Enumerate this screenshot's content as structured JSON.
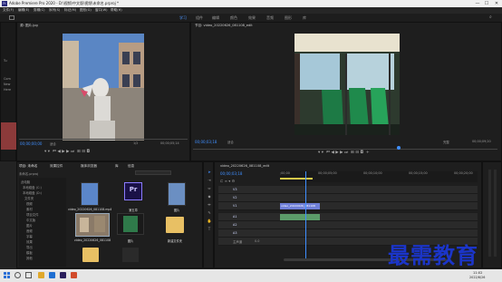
{
  "titlebar": {
    "title": "Adobe Premiere Pro 2020 - D:\\视频\\中文版\\视频\\未命名.prproj *",
    "minimize": "—",
    "maximize": "☐",
    "close": "✕"
  },
  "menu": [
    "文件(F)",
    "编辑(E)",
    "剪辑(C)",
    "序列(S)",
    "标记(M)",
    "图形(G)",
    "窗口(W)",
    "帮助(H)"
  ],
  "workspaces": [
    "学习",
    "组件",
    "编辑",
    "颜色",
    "效果",
    "音频",
    "图形",
    "库"
  ],
  "source": {
    "title": "源: 图片.jpg",
    "timecode_left": "00;00;00;00",
    "fit": "适合",
    "scale": "1/2",
    "timecode_right": "00;00;05;14"
  },
  "program": {
    "title": "节目: video_20220626_081108_edit",
    "timecode_left": "00;00;03;18",
    "fit": "适合",
    "scale": "完整",
    "timecode_right": "00;00;09;20"
  },
  "effect_controls_hint": [
    "Tu",
    "Com",
    "New",
    "Here"
  ],
  "project": {
    "tabs": [
      "项目: 未命名",
      "效果控件",
      "媒体浏览器",
      "库",
      "信息"
    ],
    "filepath": "未命名.prproj",
    "tree": [
      "此电脑",
      "本地磁盘 (C:)",
      "本地磁盘 (D:)",
      "文件夹",
      "视频",
      "素材",
      "项目文件",
      "中文版",
      "图片",
      "音频",
      "字幕",
      "效果",
      "导出",
      "模板",
      "其他"
    ],
    "items": [
      {
        "label": "video_20220626_081108.mp4",
        "kind": "blue"
      },
      {
        "label": "第五章",
        "kind": "pr"
      },
      {
        "label": "图片",
        "kind": "blue"
      },
      {
        "label": "video_20220626_081108",
        "kind": "street"
      },
      {
        "label": "图片",
        "kind": "tram"
      },
      {
        "label": "新建文件夹",
        "kind": "folder"
      },
      {
        "label": "",
        "kind": "folder"
      },
      {
        "label": "",
        "kind": "dark"
      }
    ]
  },
  "timeline": {
    "title": "video_20220626_081108_edit",
    "timecode": "00;00;03;18",
    "ruler": [
      ";00;00",
      "00;00;05;00",
      "00;00;10;00",
      "00;00;15;00",
      "00;00;20;00"
    ],
    "tracks": [
      "V3",
      "V2",
      "V1",
      "A1",
      "A2",
      "A3",
      "主声道"
    ],
    "master_value": "0.0",
    "clip_video": "video_20220626_081108",
    "clip_audio": ""
  },
  "taskbar": {
    "time": "11:02",
    "date": "2022/6/26"
  },
  "watermark": "最需教育",
  "colors": {
    "accent": "#3f8fff",
    "timeline_clip": "#6f7fd8",
    "watermark": "#1b35c9"
  }
}
